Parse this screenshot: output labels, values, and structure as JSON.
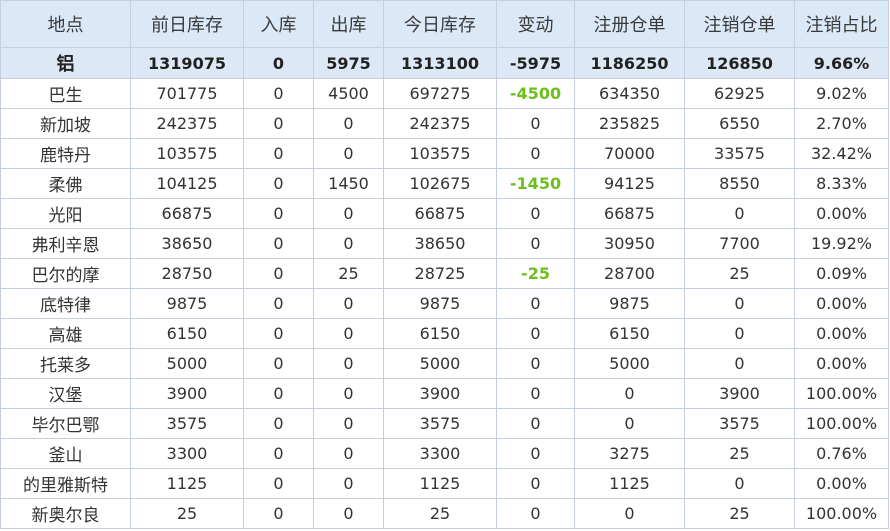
{
  "table": {
    "headers": [
      "地点",
      "前日库存",
      "入库",
      "出库",
      "今日库存",
      "变动",
      "注册仓单",
      "注销仓单",
      "注销占比"
    ],
    "rows": [
      [
        "铝",
        "1319075",
        "0",
        "5975",
        "1313100",
        "-5975",
        "1186250",
        "126850",
        "9.66%"
      ],
      [
        "巴生",
        "701775",
        "0",
        "4500",
        "697275",
        "-4500",
        "634350",
        "62925",
        "9.02%"
      ],
      [
        "新加坡",
        "242375",
        "0",
        "0",
        "242375",
        "0",
        "235825",
        "6550",
        "2.70%"
      ],
      [
        "鹿特丹",
        "103575",
        "0",
        "0",
        "103575",
        "0",
        "70000",
        "33575",
        "32.42%"
      ],
      [
        "柔佛",
        "104125",
        "0",
        "1450",
        "102675",
        "-1450",
        "94125",
        "8550",
        "8.33%"
      ],
      [
        "光阳",
        "66875",
        "0",
        "0",
        "66875",
        "0",
        "66875",
        "0",
        "0.00%"
      ],
      [
        "弗利辛恩",
        "38650",
        "0",
        "0",
        "38650",
        "0",
        "30950",
        "7700",
        "19.92%"
      ],
      [
        "巴尔的摩",
        "28750",
        "0",
        "25",
        "28725",
        "-25",
        "28700",
        "25",
        "0.09%"
      ],
      [
        "底特律",
        "9875",
        "0",
        "0",
        "9875",
        "0",
        "9875",
        "0",
        "0.00%"
      ],
      [
        "高雄",
        "6150",
        "0",
        "0",
        "6150",
        "0",
        "6150",
        "0",
        "0.00%"
      ],
      [
        "托莱多",
        "5000",
        "0",
        "0",
        "5000",
        "0",
        "5000",
        "0",
        "0.00%"
      ],
      [
        "汉堡",
        "3900",
        "0",
        "0",
        "3900",
        "0",
        "0",
        "3900",
        "100.00%"
      ],
      [
        "毕尔巴鄂",
        "3575",
        "0",
        "0",
        "3575",
        "0",
        "0",
        "3575",
        "100.00%"
      ],
      [
        "釜山",
        "3300",
        "0",
        "0",
        "3300",
        "0",
        "3275",
        "25",
        "0.76%"
      ],
      [
        "的里雅斯特",
        "1125",
        "0",
        "0",
        "1125",
        "0",
        "1125",
        "0",
        "0.00%"
      ],
      [
        "新奥尔良",
        "25",
        "0",
        "0",
        "25",
        "0",
        "0",
        "25",
        "100.00%"
      ]
    ]
  },
  "colors": {
    "header_bg": "#dbe8f8",
    "total_row_bg": "#dde8f6",
    "border": "#c3cfe0",
    "negative_change": "#6cbf1c"
  }
}
